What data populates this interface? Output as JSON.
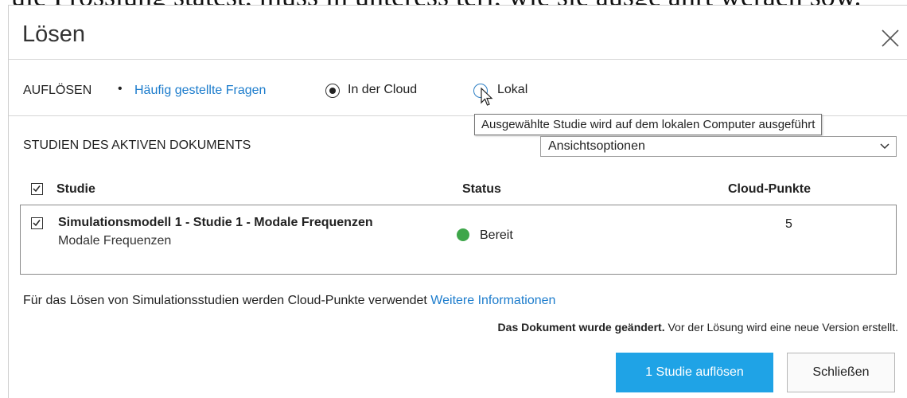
{
  "background_text": "ule Frösslung statest, muss in unteress terl, wie sie ausge ahrt weraen sow.",
  "dialog": {
    "title": "Lösen",
    "close_icon": "close-icon"
  },
  "nav": {
    "resolve_label": "AUFLÖSEN",
    "separator": "•",
    "faq_link": "Häufig gestellte Fragen",
    "options": [
      {
        "label": "In der Cloud",
        "selected": true
      },
      {
        "label": "Lokal",
        "selected": false
      }
    ],
    "tooltip": "Ausgewählte Studie wird auf dem lokalen Computer ausgeführt"
  },
  "studies": {
    "section_title": "STUDIEN DES AKTIVEN DOKUMENTS",
    "view_options": "Ansichtsoptionen",
    "columns": {
      "study": "Studie",
      "status": "Status",
      "points": "Cloud-Punkte"
    },
    "rows": [
      {
        "checked": true,
        "title": "Simulationsmodell 1 - Studie 1 - Modale Frequenzen",
        "subtitle": "Modale Frequenzen",
        "status": "Bereit",
        "status_color": "#3ea64a",
        "points": "5"
      }
    ]
  },
  "footer": {
    "info_text": "Für das Lösen von Simulationsstudien werden Cloud-Punkte verwendet",
    "info_link": "Weitere Informationen",
    "notice_bold": "Das Dokument wurde geändert.",
    "notice_text": " Vor der Lösung wird eine neue Version erstellt.",
    "primary_button": "1 Studie auflösen",
    "secondary_button": "Schließen"
  },
  "colors": {
    "accent": "#1fa3e6",
    "link": "#1c7ccc",
    "status_ready": "#3ea64a"
  }
}
